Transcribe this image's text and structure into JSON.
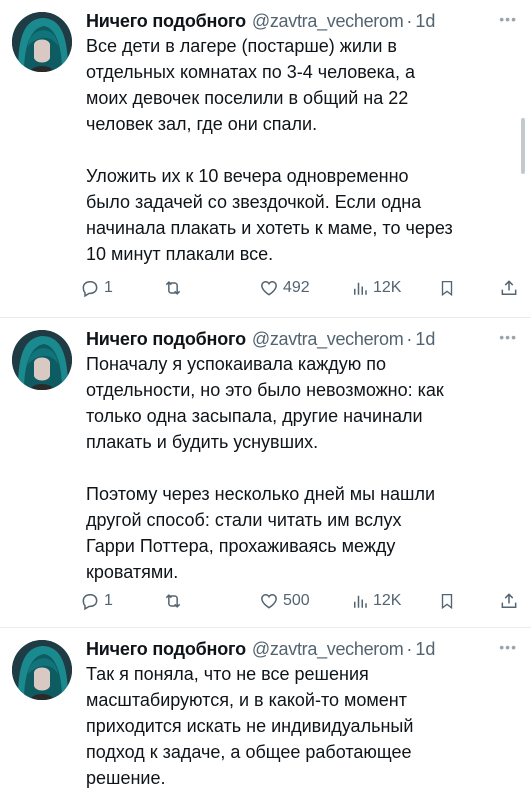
{
  "tweets": [
    {
      "author": {
        "name": "Ничего подобного",
        "handle": "@zavtra_vecherom",
        "time": "1d"
      },
      "paragraphs": [
        "Все дети в лагере (постарше) жили в\nотдельных комнатах по 3-4 человека, а\nмоих девочек поселили в общий на 22\nчеловек зал, где они спали.",
        "Уложить их к 10 вечера одновременно\nбыло задачей со звездочкой. Если одна\nначинала плакать и хотеть к маме, то через\n10 минут плакали все."
      ],
      "stats": {
        "replies": "1",
        "likes": "492",
        "views": "12K"
      }
    },
    {
      "author": {
        "name": "Ничего подобного",
        "handle": "@zavtra_vecherom",
        "time": "1d"
      },
      "paragraphs": [
        "Поначалу я успокаивала каждую по\nотдельности, но это было невозможно: как\nтолько одна засыпала, другие начинали\nплакать и будить уснувших.",
        "Поэтому через несколько дней мы нашли\nдругой способ: стали читать им вслух\nГарри Поттера, прохаживаясь между\nкроватями."
      ],
      "stats": {
        "replies": "1",
        "likes": "500",
        "views": "12K"
      }
    },
    {
      "author": {
        "name": "Ничего подобного",
        "handle": "@zavtra_vecherom",
        "time": "1d"
      },
      "paragraphs": [
        "Так я поняла, что не все решения\nмасштабируются, и в какой-то момент\nприходится искать не индивидуальный\nподход к задаче, а общее работающее\nрешение."
      ]
    }
  ],
  "icons": {
    "more": "more-horizontal-icon",
    "reply": "reply-icon",
    "retweet": "retweet-icon",
    "like": "heart-icon",
    "views": "views-chart-icon",
    "bookmark": "bookmark-icon",
    "share": "share-icon"
  },
  "colors": {
    "text": "#0f1419",
    "secondary": "#536471",
    "divider": "#e6ecf0",
    "background": "#ffffff"
  }
}
